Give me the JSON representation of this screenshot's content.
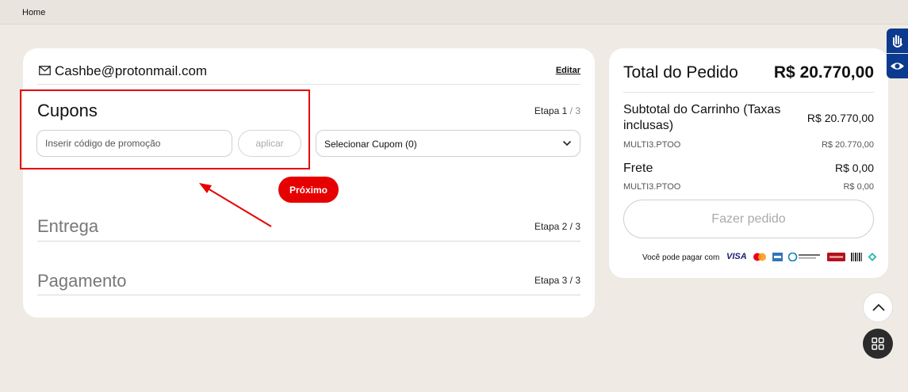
{
  "breadcrumb": {
    "home": "Home"
  },
  "account": {
    "email": "Cashbe@protonmail.com",
    "edit_label": "Editar"
  },
  "steps": {
    "coupons": {
      "title": "Cupons",
      "step_word": "Etapa",
      "current": "1",
      "rest": "/ 3"
    },
    "delivery": {
      "title": "Entrega",
      "label": "Etapa 2 / 3"
    },
    "payment": {
      "title": "Pagamento",
      "label": "Etapa 3 / 3"
    }
  },
  "coupon_form": {
    "input_placeholder": "Inserir código de promoção",
    "apply_label": "aplicar",
    "select_label": "Selecionar Cupom (0)",
    "next_label": "Próximo"
  },
  "summary": {
    "total_label": "Total do Pedido",
    "total_value": "R$ 20.770,00",
    "subtotal_label": "Subtotal do Carrinho (Taxas inclusas)",
    "subtotal_value": "R$ 20.770,00",
    "subtotal_item": "MULTI3.PTOO",
    "subtotal_item_value": "R$ 20.770,00",
    "shipping_label": "Frete",
    "shipping_value": "R$ 0,00",
    "shipping_item": "MULTI3.PTOO",
    "shipping_item_value": "R$ 0,00",
    "order_button": "Fazer pedido",
    "pay_with": "Você pode pagar com",
    "card_visa": "VISA"
  },
  "colors": {
    "accent": "#e60000",
    "side_tab": "#0b3a8f",
    "background": "#efebe4"
  }
}
